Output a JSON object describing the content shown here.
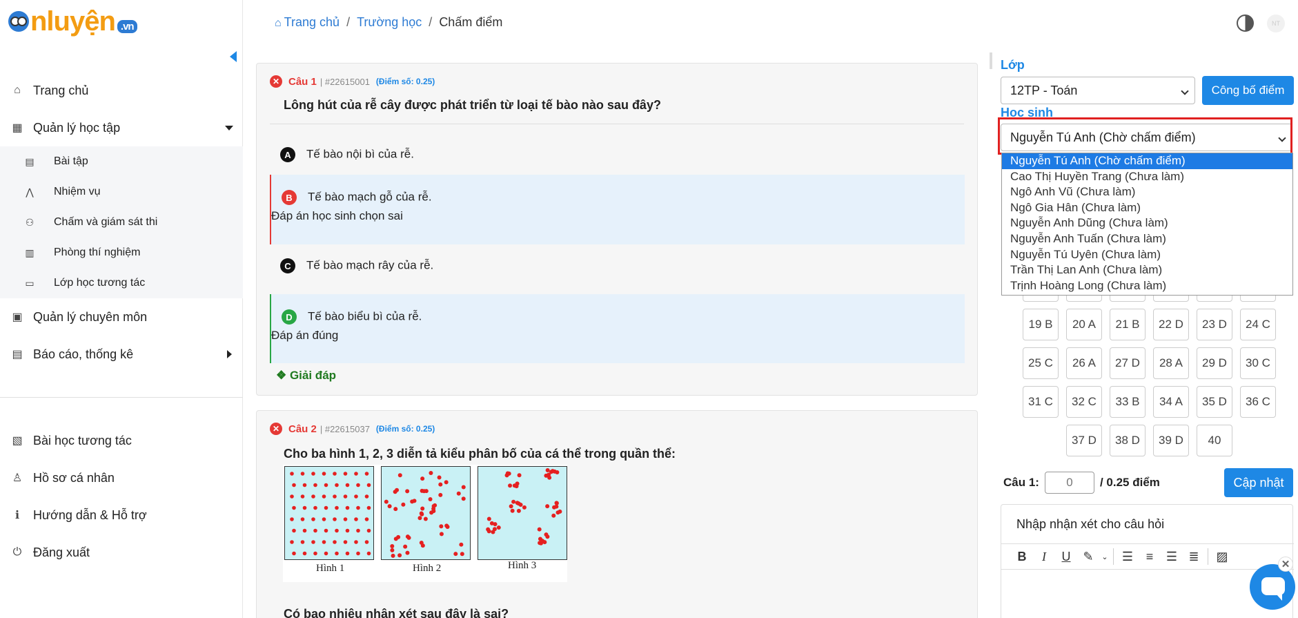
{
  "brand": {
    "logo_text": "nluyện",
    "logo_domain": ".vn"
  },
  "breadcrumb": {
    "home": "Trang chủ",
    "schools": "Trường học",
    "current": "Chấm điểm",
    "separator": "/"
  },
  "sidebar": {
    "items": [
      {
        "label": "Trang chủ",
        "icon": "home-icon"
      },
      {
        "label": "Quản lý học tập",
        "icon": "building-icon"
      }
    ],
    "sub_items": [
      {
        "label": "Bài tập",
        "icon": "clipboard-icon"
      },
      {
        "label": "Nhiệm vụ",
        "icon": "compass-icon"
      },
      {
        "label": "Chấm và giám sát thi",
        "icon": "people-icon"
      },
      {
        "label": "Phòng thí nghiệm",
        "icon": "lab-icon"
      },
      {
        "label": "Lớp học tương tác",
        "icon": "monitor-icon"
      }
    ],
    "items_after": [
      {
        "label": "Quản lý chuyên môn",
        "icon": "calendar-icon"
      },
      {
        "label": "Báo cáo, thống kê",
        "icon": "report-icon"
      }
    ],
    "bottom_items": [
      {
        "label": "Bài học tương tác",
        "icon": "lesson-icon"
      },
      {
        "label": "Hồ sơ cá nhân",
        "icon": "user-icon"
      },
      {
        "label": "Hướng dẫn & Hỗ trợ",
        "icon": "help-icon"
      },
      {
        "label": "Đăng xuất",
        "icon": "power-icon"
      }
    ]
  },
  "avatar_text": "NT",
  "question1": {
    "num": "Câu 1",
    "id": "| #22615001",
    "score": "(Điểm số: 0.25)",
    "text": "Lông hút của rễ cây được phát triển từ loại tế bào nào sau đây?",
    "options": [
      {
        "letter": "A",
        "text": "Tế bào nội bì của rễ.",
        "note": ""
      },
      {
        "letter": "B",
        "text": "Tế bào mạch gỗ của rễ.",
        "note": "Đáp án học sinh chọn sai"
      },
      {
        "letter": "C",
        "text": "Tế bào mạch rây của rễ.",
        "note": ""
      },
      {
        "letter": "D",
        "text": "Tế bào biểu bì của rễ.",
        "note": "Đáp án đúng"
      }
    ],
    "explain": "❖ Giải đáp"
  },
  "question2": {
    "num": "Câu 2",
    "id": "| #22615037",
    "score": "(Điểm số: 0.25)",
    "text": "Cho ba hình 1, 2, 3 diễn tả kiểu phân bố của cá thể trong quần thể:",
    "figures": [
      "Hình 1",
      "Hình 2",
      "Hình 3"
    ],
    "bottom_text_a": "Có bao nhiêu nhận xét sau đây là ",
    "bottom_text_b": "sai?"
  },
  "panel": {
    "class_label": "Lớp",
    "class_value": "12TP - Toán",
    "publish_button": "Công bố điểm",
    "student_label": "Học sinh",
    "student_value": "Nguyễn Tú Anh (Chờ chấm điểm)",
    "student_options": [
      "Nguyễn Tú Anh (Chờ chấm điểm)",
      "Cao Thị Huyền Trang (Chưa làm)",
      "Ngô Anh Vũ (Chưa làm)",
      "Ngô Gia Hân (Chưa làm)",
      "Nguyễn Anh Dũng (Chưa làm)",
      "Nguyễn Anh Tuấn (Chưa làm)",
      "Nguyễn Tú Uyên (Chưa làm)",
      "Trần Thị Lan Anh (Chưa làm)",
      "Trịnh Hoàng Long (Chưa làm)"
    ],
    "answer_grid": [
      [
        "19 B",
        "20 A",
        "21 B",
        "22 D",
        "23 D",
        "24 C"
      ],
      [
        "25 C",
        "26 A",
        "27 D",
        "28 A",
        "29 D",
        "30 C"
      ],
      [
        "31 C",
        "32 C",
        "33 B",
        "34 A",
        "35 D",
        "36 C"
      ],
      [
        "37 D",
        "38 D",
        "39 D",
        "40"
      ]
    ],
    "score_label": "Câu 1:",
    "score_value": "0",
    "score_max": "/ 0.25 điểm",
    "update_button": "Cập nhật",
    "comment_title": "Nhập nhận xét cho câu hỏi"
  },
  "colors": {
    "accent": "#1e88e5",
    "wrong": "#e53935",
    "correct": "#28a745",
    "highlight": "#e02020"
  }
}
